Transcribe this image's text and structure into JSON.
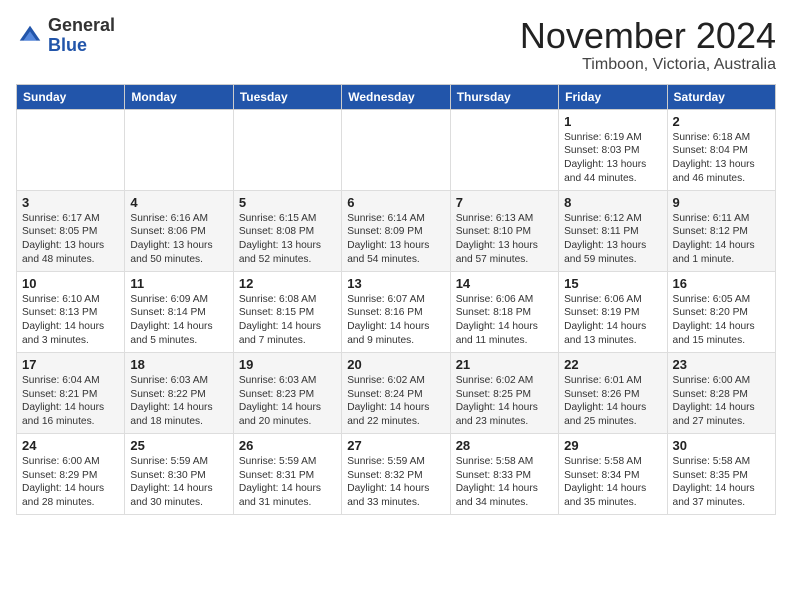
{
  "logo": {
    "general": "General",
    "blue": "Blue"
  },
  "title": "November 2024",
  "location": "Timboon, Victoria, Australia",
  "days_header": [
    "Sunday",
    "Monday",
    "Tuesday",
    "Wednesday",
    "Thursday",
    "Friday",
    "Saturday"
  ],
  "weeks": [
    [
      {
        "day": "",
        "info": ""
      },
      {
        "day": "",
        "info": ""
      },
      {
        "day": "",
        "info": ""
      },
      {
        "day": "",
        "info": ""
      },
      {
        "day": "",
        "info": ""
      },
      {
        "day": "1",
        "info": "Sunrise: 6:19 AM\nSunset: 8:03 PM\nDaylight: 13 hours\nand 44 minutes."
      },
      {
        "day": "2",
        "info": "Sunrise: 6:18 AM\nSunset: 8:04 PM\nDaylight: 13 hours\nand 46 minutes."
      }
    ],
    [
      {
        "day": "3",
        "info": "Sunrise: 6:17 AM\nSunset: 8:05 PM\nDaylight: 13 hours\nand 48 minutes."
      },
      {
        "day": "4",
        "info": "Sunrise: 6:16 AM\nSunset: 8:06 PM\nDaylight: 13 hours\nand 50 minutes."
      },
      {
        "day": "5",
        "info": "Sunrise: 6:15 AM\nSunset: 8:08 PM\nDaylight: 13 hours\nand 52 minutes."
      },
      {
        "day": "6",
        "info": "Sunrise: 6:14 AM\nSunset: 8:09 PM\nDaylight: 13 hours\nand 54 minutes."
      },
      {
        "day": "7",
        "info": "Sunrise: 6:13 AM\nSunset: 8:10 PM\nDaylight: 13 hours\nand 57 minutes."
      },
      {
        "day": "8",
        "info": "Sunrise: 6:12 AM\nSunset: 8:11 PM\nDaylight: 13 hours\nand 59 minutes."
      },
      {
        "day": "9",
        "info": "Sunrise: 6:11 AM\nSunset: 8:12 PM\nDaylight: 14 hours\nand 1 minute."
      }
    ],
    [
      {
        "day": "10",
        "info": "Sunrise: 6:10 AM\nSunset: 8:13 PM\nDaylight: 14 hours\nand 3 minutes."
      },
      {
        "day": "11",
        "info": "Sunrise: 6:09 AM\nSunset: 8:14 PM\nDaylight: 14 hours\nand 5 minutes."
      },
      {
        "day": "12",
        "info": "Sunrise: 6:08 AM\nSunset: 8:15 PM\nDaylight: 14 hours\nand 7 minutes."
      },
      {
        "day": "13",
        "info": "Sunrise: 6:07 AM\nSunset: 8:16 PM\nDaylight: 14 hours\nand 9 minutes."
      },
      {
        "day": "14",
        "info": "Sunrise: 6:06 AM\nSunset: 8:18 PM\nDaylight: 14 hours\nand 11 minutes."
      },
      {
        "day": "15",
        "info": "Sunrise: 6:06 AM\nSunset: 8:19 PM\nDaylight: 14 hours\nand 13 minutes."
      },
      {
        "day": "16",
        "info": "Sunrise: 6:05 AM\nSunset: 8:20 PM\nDaylight: 14 hours\nand 15 minutes."
      }
    ],
    [
      {
        "day": "17",
        "info": "Sunrise: 6:04 AM\nSunset: 8:21 PM\nDaylight: 14 hours\nand 16 minutes."
      },
      {
        "day": "18",
        "info": "Sunrise: 6:03 AM\nSunset: 8:22 PM\nDaylight: 14 hours\nand 18 minutes."
      },
      {
        "day": "19",
        "info": "Sunrise: 6:03 AM\nSunset: 8:23 PM\nDaylight: 14 hours\nand 20 minutes."
      },
      {
        "day": "20",
        "info": "Sunrise: 6:02 AM\nSunset: 8:24 PM\nDaylight: 14 hours\nand 22 minutes."
      },
      {
        "day": "21",
        "info": "Sunrise: 6:02 AM\nSunset: 8:25 PM\nDaylight: 14 hours\nand 23 minutes."
      },
      {
        "day": "22",
        "info": "Sunrise: 6:01 AM\nSunset: 8:26 PM\nDaylight: 14 hours\nand 25 minutes."
      },
      {
        "day": "23",
        "info": "Sunrise: 6:00 AM\nSunset: 8:28 PM\nDaylight: 14 hours\nand 27 minutes."
      }
    ],
    [
      {
        "day": "24",
        "info": "Sunrise: 6:00 AM\nSunset: 8:29 PM\nDaylight: 14 hours\nand 28 minutes."
      },
      {
        "day": "25",
        "info": "Sunrise: 5:59 AM\nSunset: 8:30 PM\nDaylight: 14 hours\nand 30 minutes."
      },
      {
        "day": "26",
        "info": "Sunrise: 5:59 AM\nSunset: 8:31 PM\nDaylight: 14 hours\nand 31 minutes."
      },
      {
        "day": "27",
        "info": "Sunrise: 5:59 AM\nSunset: 8:32 PM\nDaylight: 14 hours\nand 33 minutes."
      },
      {
        "day": "28",
        "info": "Sunrise: 5:58 AM\nSunset: 8:33 PM\nDaylight: 14 hours\nand 34 minutes."
      },
      {
        "day": "29",
        "info": "Sunrise: 5:58 AM\nSunset: 8:34 PM\nDaylight: 14 hours\nand 35 minutes."
      },
      {
        "day": "30",
        "info": "Sunrise: 5:58 AM\nSunset: 8:35 PM\nDaylight: 14 hours\nand 37 minutes."
      }
    ]
  ]
}
